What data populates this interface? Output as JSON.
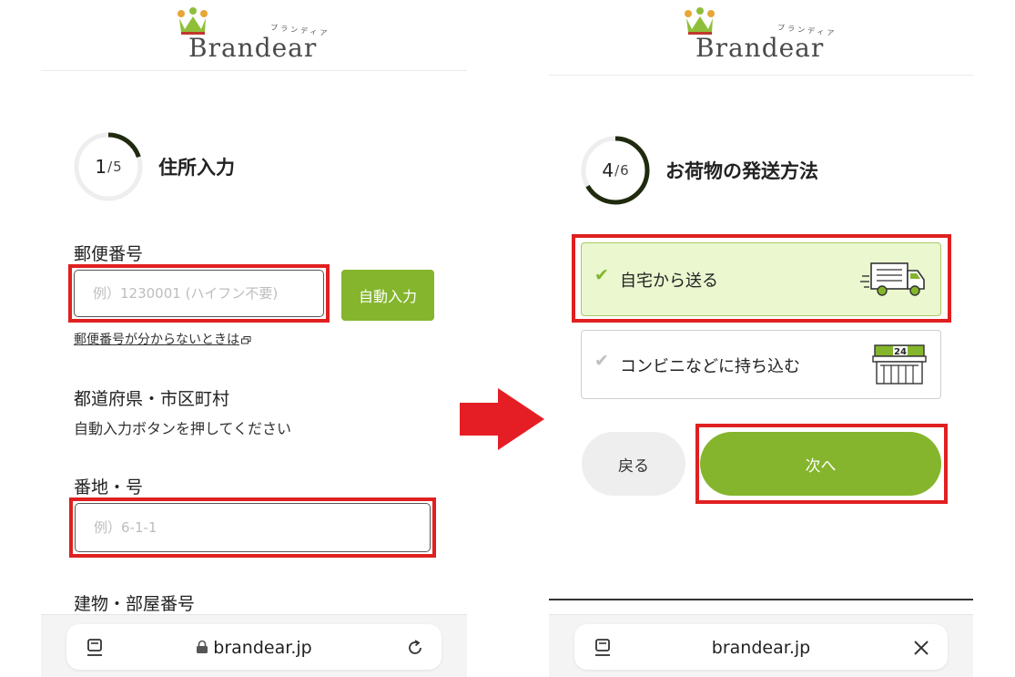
{
  "left": {
    "logo": {
      "word": "Brandear",
      "kana": "ブランディア"
    },
    "step": {
      "current": "1",
      "total": "5",
      "progress": 0.2,
      "title": "住所入力"
    },
    "postal": {
      "label": "郵便番号",
      "placeholder": "例）1230001 (ハイフン不要)",
      "auto_button": "自動入力",
      "help_link": "郵便番号が分からないときは"
    },
    "prefecture": {
      "label": "都道府県・市区町村",
      "hint": "自動入力ボタンを押してください"
    },
    "street": {
      "label": "番地・号",
      "placeholder": "例）6-1-1"
    },
    "building": {
      "label": "建物・部屋番号"
    },
    "browser": {
      "url": "brandear.jp"
    }
  },
  "right": {
    "logo": {
      "word": "Brandear",
      "kana": "ブランディア"
    },
    "step": {
      "current": "4",
      "total": "6",
      "progress": 0.667,
      "title": "お荷物の発送方法"
    },
    "options": [
      {
        "label": "自宅から送る",
        "selected": true,
        "icon": "delivery-truck-icon"
      },
      {
        "label": "コンビニなどに持ち込む",
        "selected": false,
        "icon": "convenience-store-icon",
        "badge": "24"
      }
    ],
    "back_button": "戻る",
    "next_button": "次へ",
    "browser": {
      "url": "brandear.jp"
    }
  },
  "colors": {
    "accent": "#84b52c",
    "highlight": "#e02020",
    "selected_bg": "#eaf7cf"
  }
}
